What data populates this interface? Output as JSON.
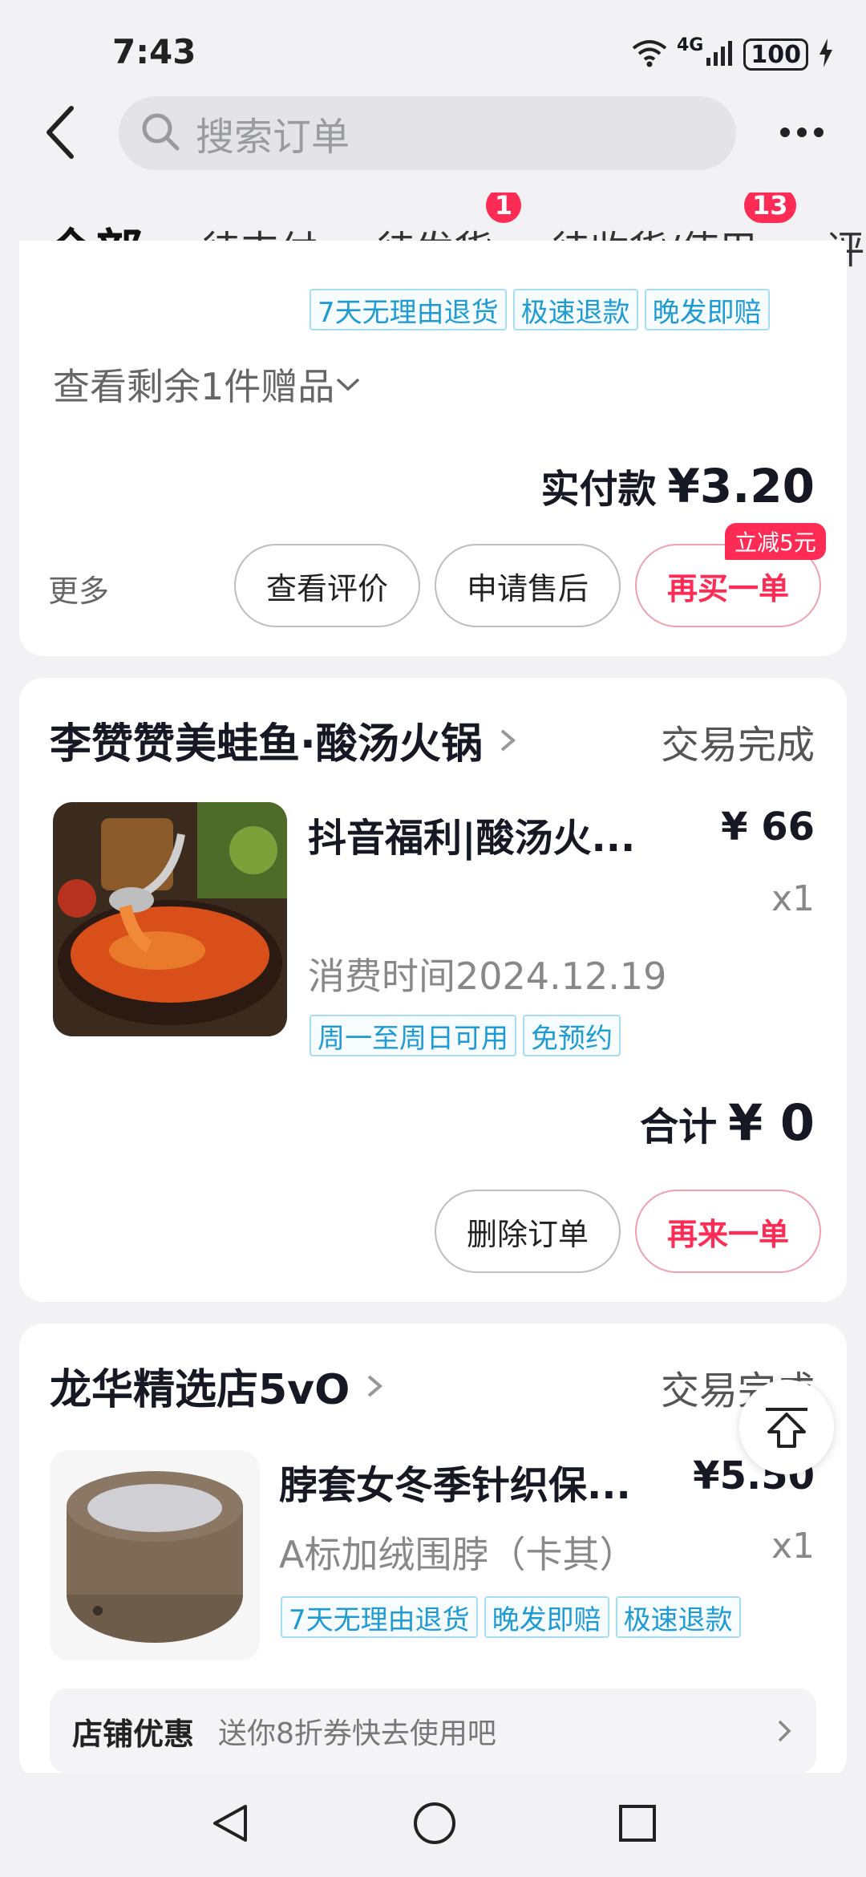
{
  "status_bar": {
    "time": "7:43",
    "network": "4G",
    "battery": "100"
  },
  "search": {
    "placeholder": "搜索订单"
  },
  "tabs": [
    {
      "label": "全部",
      "badge": ""
    },
    {
      "label": "待支付",
      "badge": ""
    },
    {
      "label": "待发货",
      "badge": "1"
    },
    {
      "label": "待收货/使用",
      "badge": "13"
    },
    {
      "label": "评",
      "badge": ""
    }
  ],
  "order1": {
    "tags": [
      "7天无理由退货",
      "极速退款",
      "晚发即赔"
    ],
    "gift_link": "查看剩余1件赠品",
    "paid_label": "实付款",
    "paid_amount": "¥3.20",
    "more": "更多",
    "buttons": [
      "查看评价",
      "申请售后",
      "再买一单"
    ],
    "promo_badge": "立减5元"
  },
  "order2": {
    "shop": "李赞赞美蛙鱼·酸汤火锅",
    "status": "交易完成",
    "title": "抖音福利|酸汤火...",
    "price": "¥ 66",
    "qty": "x1",
    "consume_time": "消费时间2024.12.19",
    "tags": [
      "周一至周日可用",
      "免预约"
    ],
    "total_label": "合计",
    "total_amount": "¥ 0",
    "buttons": [
      "删除订单",
      "再来一单"
    ]
  },
  "order3": {
    "shop": "龙华精选店5vO",
    "status": "交易完成",
    "title": "脖套女冬季针织保...",
    "price": "¥5.50",
    "spec": "A标加绒围脖（卡其）",
    "qty": "x1",
    "tags": [
      "7天无理由退货",
      "晚发即赔",
      "极速退款"
    ],
    "promo_label": "店铺优惠",
    "promo_text": "送你8折券快去使用吧"
  },
  "colors": {
    "accent": "#fe2c55",
    "tag": "#1f9bd4",
    "bg": "#f2f2f4"
  }
}
